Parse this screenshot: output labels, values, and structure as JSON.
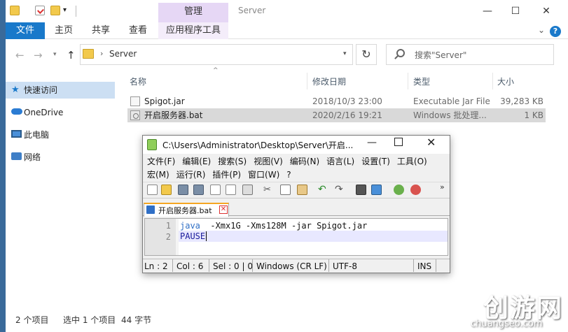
{
  "window": {
    "title": "Server",
    "contextual_tab": "管理"
  },
  "ribbon": {
    "tabs": [
      "文件",
      "主页",
      "共享",
      "查看",
      "应用程序工具"
    ]
  },
  "address": {
    "path": "Server",
    "search_placeholder": "搜索\"Server\""
  },
  "navpane": {
    "items": [
      "快速访问",
      "OneDrive",
      "此电脑",
      "网络"
    ]
  },
  "filelist": {
    "columns": [
      "名称",
      "修改日期",
      "类型",
      "大小"
    ],
    "rows": [
      {
        "name": "Spigot.jar",
        "date": "2018/10/3 23:00",
        "type": "Executable Jar File",
        "size": "39,283 KB"
      },
      {
        "name": "开启服务器.bat",
        "date": "2020/2/16 19:21",
        "type": "Windows 批处理...",
        "size": "1 KB"
      }
    ]
  },
  "statusbar": {
    "count": "2 个项目",
    "selected": "选中 1 个项目",
    "size": "44 字节"
  },
  "npp": {
    "title": "C:\\Users\\Administrator\\Desktop\\Server\\开启...",
    "menu_row1": [
      "文件(F)",
      "编辑(E)",
      "搜索(S)",
      "视图(V)",
      "编码(N)",
      "语言(L)",
      "设置(T)",
      "工具(O)"
    ],
    "menu_row2": [
      "宏(M)",
      "运行(R)",
      "插件(P)",
      "窗口(W)",
      "?"
    ],
    "tab_label": "开启服务器.bat",
    "lines": [
      {
        "num": "1",
        "keyword": "java",
        "rest": "  -Xmx1G -Xms128M -jar Spigot.jar"
      },
      {
        "num": "2",
        "keyword": "PAUSE",
        "rest": ""
      }
    ],
    "status": {
      "ln": "Ln : 2",
      "col": "Col : 6",
      "sel": "Sel : 0 | 0",
      "eol": "Windows (CR LF)",
      "enc": "UTF-8",
      "ins": "INS"
    }
  },
  "watermark": {
    "logo": "创游网",
    "url": "chuangseo.com"
  },
  "colors": {
    "accent": "#1979ca",
    "contextual_tab": "#e6d7f5",
    "selection": "#ccdff3",
    "npp_keyword": "#2f6fc6"
  }
}
